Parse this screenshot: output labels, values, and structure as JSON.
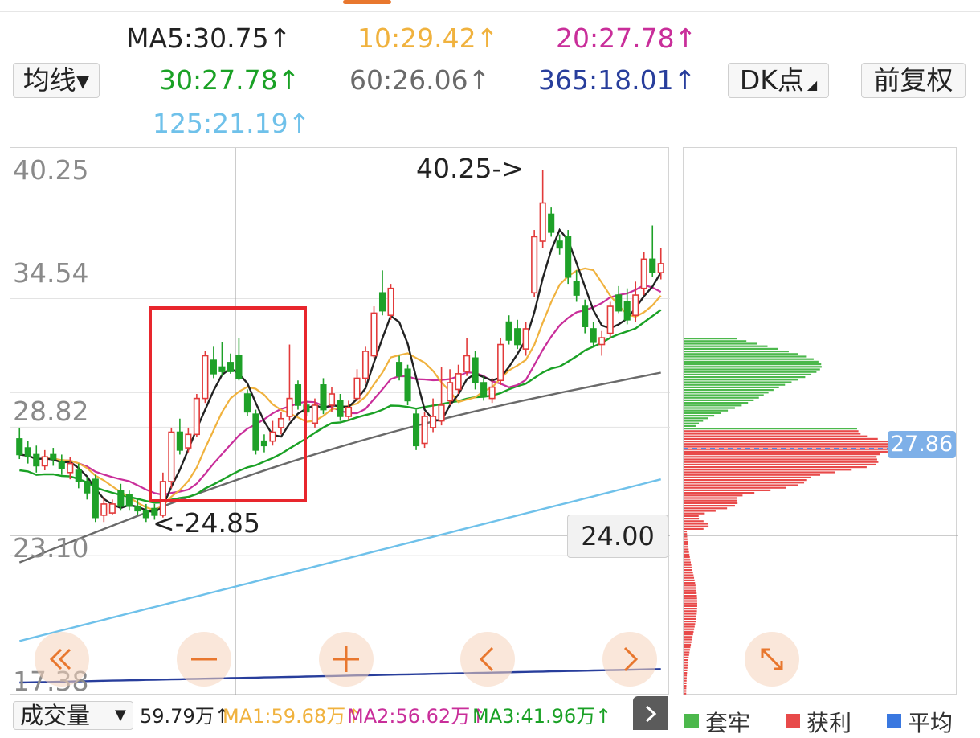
{
  "header": {
    "ma_row1": [
      {
        "text": "MA5:30.75↑",
        "color": "#222222"
      },
      {
        "text": "10:29.42↑",
        "color": "#f0b23e"
      },
      {
        "text": "20:27.78↑",
        "color": "#c92e9a"
      }
    ],
    "ma_row2": [
      {
        "text": "30:27.78↑",
        "color": "#1aa125"
      },
      {
        "text": "60:26.06↑",
        "color": "#6a6a6a"
      },
      {
        "text": "365:18.01↑",
        "color": "#283e9c"
      }
    ],
    "ma_row3": [
      {
        "text": "125:21.19↑",
        "color": "#6fc1ea"
      }
    ]
  },
  "buttons": {
    "indicator": "均线▾",
    "dk": "DK点",
    "adjust": "前复权"
  },
  "price_axis": [
    "40.25",
    "34.54",
    "28.82",
    "23.10",
    "17.38"
  ],
  "annotations": {
    "high": "40.25->",
    "low": "<-24.85",
    "crosshair_price": "24.00"
  },
  "chip": {
    "avg_label": "27.86",
    "legend": [
      {
        "label": "套牢",
        "color": "#4cb84c"
      },
      {
        "label": "获利",
        "color": "#e84a4a"
      },
      {
        "label": "平均",
        "color": "#3a78e0"
      }
    ]
  },
  "volume": {
    "selector": "成交量",
    "value": "59.79万↑",
    "ma1": "MA1:59.68万↑",
    "ma2": "MA2:56.62万↑",
    "ma3": "MA3:41.96万↑",
    "colors": {
      "ma1": "#f0b23e",
      "ma2": "#c92e9a",
      "ma3": "#1aa125"
    }
  },
  "colors": {
    "up": "#e23a3a",
    "down": "#1ea128",
    "highlight": "#e8262d",
    "accent": "#e8772e"
  },
  "chart_data": {
    "type": "candlestick",
    "y_axis_ticks": [
      40.25,
      34.54,
      28.82,
      23.1,
      17.38
    ],
    "ylim": [
      17.38,
      40.25
    ],
    "marked_high": 40.25,
    "marked_low": 24.85,
    "crosshair_price": 24.0,
    "average_cost": 27.86,
    "moving_averages": [
      {
        "name": "MA5",
        "value": 30.75
      },
      {
        "name": "10",
        "value": 29.42
      },
      {
        "name": "20",
        "value": 27.78
      },
      {
        "name": "30",
        "value": 27.78
      },
      {
        "name": "60",
        "value": 26.06
      },
      {
        "name": "365",
        "value": 18.01
      },
      {
        "name": "125",
        "value": 21.19
      }
    ],
    "candles": [
      {
        "o": 28.3,
        "c": 27.6,
        "h": 28.8,
        "l": 27.4
      },
      {
        "o": 27.9,
        "c": 27.5,
        "h": 28.2,
        "l": 27.2
      },
      {
        "o": 27.6,
        "c": 27.1,
        "h": 28.0,
        "l": 26.8
      },
      {
        "o": 27.1,
        "c": 27.5,
        "h": 27.8,
        "l": 26.9
      },
      {
        "o": 27.6,
        "c": 27.4,
        "h": 27.9,
        "l": 27.1
      },
      {
        "o": 27.3,
        "c": 27.0,
        "h": 27.6,
        "l": 26.7
      },
      {
        "o": 26.8,
        "c": 27.2,
        "h": 27.5,
        "l": 26.5
      },
      {
        "o": 26.9,
        "c": 26.4,
        "h": 27.2,
        "l": 26.1
      },
      {
        "o": 26.4,
        "c": 25.9,
        "h": 26.6,
        "l": 25.6
      },
      {
        "o": 26.5,
        "c": 24.8,
        "h": 26.7,
        "l": 24.6
      },
      {
        "o": 24.9,
        "c": 25.4,
        "h": 25.7,
        "l": 24.6
      },
      {
        "o": 25.0,
        "c": 25.4,
        "h": 25.6,
        "l": 24.9
      },
      {
        "o": 26.0,
        "c": 25.3,
        "h": 26.3,
        "l": 25.1
      },
      {
        "o": 25.8,
        "c": 25.3,
        "h": 26.0,
        "l": 25.1
      },
      {
        "o": 25.3,
        "c": 25.1,
        "h": 25.6,
        "l": 24.9
      },
      {
        "o": 25.1,
        "c": 24.8,
        "h": 25.4,
        "l": 24.6
      },
      {
        "o": 25.2,
        "c": 24.9,
        "h": 25.4,
        "l": 24.7
      },
      {
        "o": 24.9,
        "c": 26.4,
        "h": 26.8,
        "l": 24.8
      },
      {
        "o": 26.4,
        "c": 28.6,
        "h": 28.8,
        "l": 26.1
      },
      {
        "o": 28.6,
        "c": 27.8,
        "h": 29.2,
        "l": 27.6
      },
      {
        "o": 27.9,
        "c": 28.5,
        "h": 28.8,
        "l": 27.7
      },
      {
        "o": 28.5,
        "c": 30.1,
        "h": 30.3,
        "l": 28.4
      },
      {
        "o": 30.1,
        "c": 32.0,
        "h": 32.2,
        "l": 29.9
      },
      {
        "o": 31.8,
        "c": 31.2,
        "h": 32.4,
        "l": 31.0
      },
      {
        "o": 31.5,
        "c": 31.3,
        "h": 32.6,
        "l": 31.1
      },
      {
        "o": 31.7,
        "c": 31.3,
        "h": 32.1,
        "l": 31.2
      },
      {
        "o": 32.0,
        "c": 31.0,
        "h": 32.8,
        "l": 30.9
      },
      {
        "o": 30.3,
        "c": 29.5,
        "h": 30.5,
        "l": 29.3
      },
      {
        "o": 29.4,
        "c": 27.8,
        "h": 29.6,
        "l": 27.6
      },
      {
        "o": 28.2,
        "c": 28.0,
        "h": 28.5,
        "l": 27.7
      },
      {
        "o": 28.2,
        "c": 28.6,
        "h": 29.1,
        "l": 28.0
      },
      {
        "o": 28.8,
        "c": 29.2,
        "h": 29.5,
        "l": 28.5
      },
      {
        "o": 29.3,
        "c": 30.1,
        "h": 32.5,
        "l": 29.1
      },
      {
        "o": 30.7,
        "c": 29.8,
        "h": 30.9,
        "l": 29.6
      },
      {
        "o": 29.8,
        "c": 29.5,
        "h": 30.0,
        "l": 29.3
      },
      {
        "o": 29.0,
        "c": 29.8,
        "h": 30.1,
        "l": 28.8
      },
      {
        "o": 30.7,
        "c": 29.6,
        "h": 31.0,
        "l": 29.4
      },
      {
        "o": 29.8,
        "c": 30.3,
        "h": 30.6,
        "l": 29.5
      },
      {
        "o": 30.0,
        "c": 29.3,
        "h": 30.3,
        "l": 29.1
      },
      {
        "o": 29.3,
        "c": 29.7,
        "h": 30.0,
        "l": 29.1
      },
      {
        "o": 30.1,
        "c": 31.0,
        "h": 31.4,
        "l": 30.0
      },
      {
        "o": 31.0,
        "c": 32.2,
        "h": 32.4,
        "l": 30.8
      },
      {
        "o": 32.0,
        "c": 33.9,
        "h": 34.2,
        "l": 31.9
      },
      {
        "o": 34.8,
        "c": 34.0,
        "h": 35.8,
        "l": 33.8
      },
      {
        "o": 33.8,
        "c": 35.0,
        "h": 35.2,
        "l": 33.6
      },
      {
        "o": 31.7,
        "c": 31.1,
        "h": 32.0,
        "l": 30.9
      },
      {
        "o": 31.4,
        "c": 30.0,
        "h": 31.6,
        "l": 29.8
      },
      {
        "o": 29.4,
        "c": 28.0,
        "h": 29.6,
        "l": 27.8
      },
      {
        "o": 28.1,
        "c": 29.3,
        "h": 29.5,
        "l": 27.9
      },
      {
        "o": 28.8,
        "c": 29.3,
        "h": 30.1,
        "l": 28.6
      },
      {
        "o": 29.1,
        "c": 29.8,
        "h": 31.5,
        "l": 28.9
      },
      {
        "o": 30.0,
        "c": 30.8,
        "h": 31.4,
        "l": 29.8
      },
      {
        "o": 30.5,
        "c": 31.2,
        "h": 31.6,
        "l": 30.3
      },
      {
        "o": 31.3,
        "c": 32.0,
        "h": 32.8,
        "l": 31.1
      },
      {
        "o": 31.9,
        "c": 30.8,
        "h": 32.2,
        "l": 30.5
      },
      {
        "o": 30.8,
        "c": 30.2,
        "h": 31.1,
        "l": 30.0
      },
      {
        "o": 30.1,
        "c": 30.6,
        "h": 31.0,
        "l": 29.9
      },
      {
        "o": 30.9,
        "c": 32.5,
        "h": 32.8,
        "l": 30.7
      },
      {
        "o": 33.5,
        "c": 32.7,
        "h": 33.8,
        "l": 32.5
      },
      {
        "o": 33.2,
        "c": 32.5,
        "h": 33.6,
        "l": 32.3
      },
      {
        "o": 32.3,
        "c": 33.2,
        "h": 33.5,
        "l": 32.0
      },
      {
        "o": 34.8,
        "c": 37.3,
        "h": 37.6,
        "l": 34.6
      },
      {
        "o": 37.1,
        "c": 38.8,
        "h": 40.25,
        "l": 36.8
      },
      {
        "o": 38.3,
        "c": 37.5,
        "h": 38.6,
        "l": 37.3
      },
      {
        "o": 37.1,
        "c": 36.8,
        "h": 37.4,
        "l": 36.5
      },
      {
        "o": 37.3,
        "c": 35.5,
        "h": 37.6,
        "l": 35.2
      },
      {
        "o": 35.3,
        "c": 34.7,
        "h": 35.8,
        "l": 34.4
      },
      {
        "o": 34.2,
        "c": 33.3,
        "h": 34.5,
        "l": 33.0
      },
      {
        "o": 33.2,
        "c": 32.6,
        "h": 33.5,
        "l": 32.4
      },
      {
        "o": 32.5,
        "c": 32.8,
        "h": 33.1,
        "l": 32.0
      },
      {
        "o": 33.0,
        "c": 34.2,
        "h": 34.4,
        "l": 32.8
      },
      {
        "o": 34.7,
        "c": 34.0,
        "h": 35.1,
        "l": 33.9
      },
      {
        "o": 34.4,
        "c": 33.6,
        "h": 35.0,
        "l": 33.4
      },
      {
        "o": 33.8,
        "c": 34.7,
        "h": 35.3,
        "l": 33.5
      },
      {
        "o": 35.0,
        "c": 36.3,
        "h": 36.6,
        "l": 34.7
      },
      {
        "o": 36.3,
        "c": 35.7,
        "h": 37.8,
        "l": 35.5
      },
      {
        "o": 35.7,
        "c": 36.1,
        "h": 36.8,
        "l": 35.4
      }
    ]
  }
}
